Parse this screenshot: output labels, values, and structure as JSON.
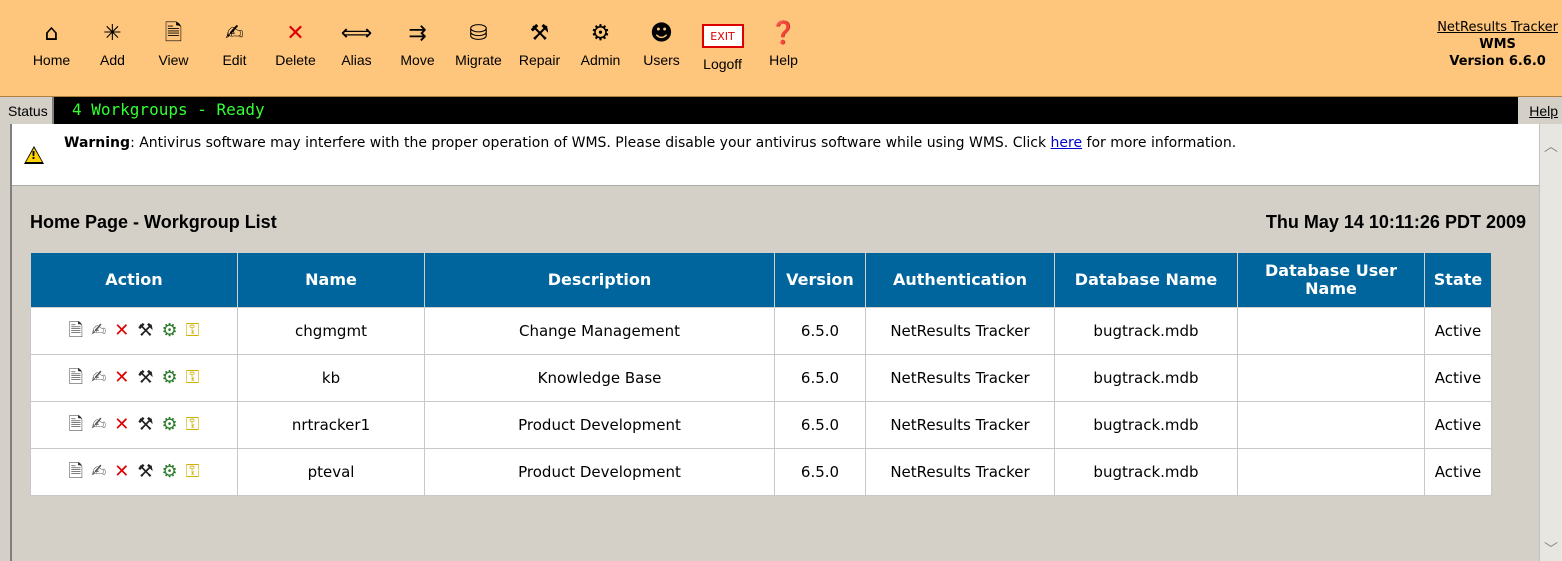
{
  "toolbar": {
    "buttons": [
      {
        "label": "Home",
        "icon": "home-icon",
        "glyph": "⌂"
      },
      {
        "label": "Add",
        "icon": "add-icon",
        "glyph": "✳"
      },
      {
        "label": "View",
        "icon": "view-icon",
        "glyph": "🗎"
      },
      {
        "label": "Edit",
        "icon": "edit-icon",
        "glyph": "✍"
      },
      {
        "label": "Delete",
        "icon": "delete-icon",
        "glyph": "✕"
      },
      {
        "label": "Alias",
        "icon": "alias-icon",
        "glyph": "⟺"
      },
      {
        "label": "Move",
        "icon": "move-icon",
        "glyph": "⇉"
      },
      {
        "label": "Migrate",
        "icon": "migrate-icon",
        "glyph": "⛁"
      },
      {
        "label": "Repair",
        "icon": "repair-icon",
        "glyph": "⚒"
      },
      {
        "label": "Admin",
        "icon": "admin-icon",
        "glyph": "⚙"
      },
      {
        "label": "Users",
        "icon": "users-icon",
        "glyph": "☻"
      },
      {
        "label": "Logoff",
        "icon": "exit-icon",
        "glyph": "EXIT"
      },
      {
        "label": "Help",
        "icon": "help-book-icon",
        "glyph": "❓"
      }
    ]
  },
  "brand": {
    "product": "NetResults Tracker",
    "name": "WMS",
    "version": "Version 6.6.0"
  },
  "status": {
    "label": "Status",
    "text": "4 Workgroups - Ready",
    "help": "Help"
  },
  "warning": {
    "prefix": "Warning",
    "text": ": Antivirus software may interfere with the proper operation of WMS. Please disable your antivirus software while using WMS. Click ",
    "link": "here",
    "suffix": " for more information."
  },
  "page": {
    "title": "Home Page - Workgroup List",
    "date": "Thu May 14 10:11:26 PDT 2009"
  },
  "table": {
    "headers": [
      "Action",
      "Name",
      "Description",
      "Version",
      "Authentication",
      "Database Name",
      "Database User Name",
      "State"
    ],
    "rows": [
      {
        "name": "chgmgmt",
        "description": "Change Management",
        "version": "6.5.0",
        "authentication": "NetResults Tracker",
        "database": "bugtrack.mdb",
        "db_user": "",
        "state": "Active"
      },
      {
        "name": "kb",
        "description": "Knowledge Base",
        "version": "6.5.0",
        "authentication": "NetResults Tracker",
        "database": "bugtrack.mdb",
        "db_user": "",
        "state": "Active"
      },
      {
        "name": "nrtracker1",
        "description": "Product Development",
        "version": "6.5.0",
        "authentication": "NetResults Tracker",
        "database": "bugtrack.mdb",
        "db_user": "",
        "state": "Active"
      },
      {
        "name": "pteval",
        "description": "Product Development",
        "version": "6.5.0",
        "authentication": "NetResults Tracker",
        "database": "bugtrack.mdb",
        "db_user": "",
        "state": "Active"
      }
    ],
    "action_icons": [
      {
        "name": "view-icon",
        "glyph": "🗎",
        "color": "#333333"
      },
      {
        "name": "edit-icon",
        "glyph": "✍",
        "color": "#555555"
      },
      {
        "name": "delete-icon",
        "glyph": "✕",
        "color": "#e00000"
      },
      {
        "name": "repair-icon",
        "glyph": "⚒",
        "color": "#222222"
      },
      {
        "name": "admin-icon",
        "glyph": "⚙",
        "color": "#2a7a2a"
      },
      {
        "name": "key-icon",
        "glyph": "⚿",
        "color": "#d0b000"
      }
    ]
  },
  "colors": {
    "toolbar_bg": "#fec57c",
    "header_bg": "#00659c",
    "status_text": "#33ff33"
  }
}
